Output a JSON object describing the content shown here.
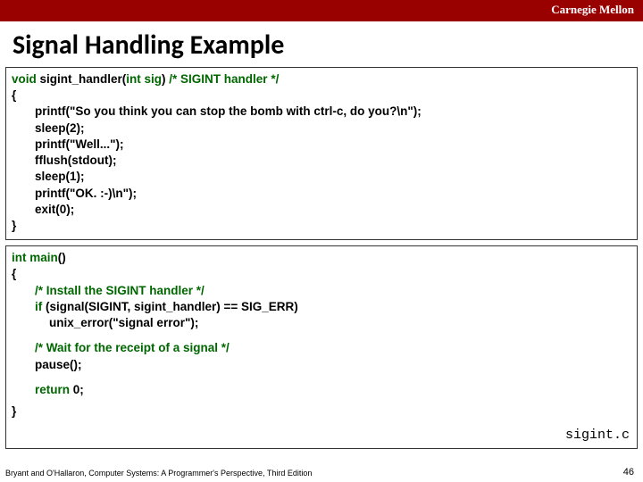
{
  "header": {
    "cmu": "Carnegie Mellon"
  },
  "title": "Signal Handling Example",
  "code1": {
    "sig_void": "void",
    "sig_name": " sigint_handler(",
    "sig_int": "int",
    "sig_param": " sig",
    "sig_close": ") ",
    "sig_comment": "/* SIGINT handler */",
    "open": "{",
    "l1": "printf(\"So you think you can stop the bomb with ctrl-c, do you?\\n\");",
    "l2": "sleep(2);",
    "l3": "printf(\"Well...\");",
    "l4": "fflush(stdout);",
    "l5": "sleep(1);",
    "l6": "printf(\"OK. :-)\\n\");",
    "l7": "exit(0);",
    "close": "}"
  },
  "code2": {
    "main_int": "int",
    "main_name": " main",
    "main_paren": "()",
    "open": "{",
    "c1": "/* Install the SIGINT handler */",
    "if_kw": "if",
    "if_rest": " (signal(SIGINT, sigint_handler) == SIG_ERR)",
    "err": "unix_error(\"signal error\");",
    "c2": "/* Wait for the receipt of a signal */",
    "pause": "pause();",
    "ret_kw": "return",
    "ret_rest": " 0;",
    "close": "}",
    "filename": "sigint.c"
  },
  "footer": {
    "left": "Bryant and O'Hallaron, Computer Systems: A Programmer's Perspective, Third Edition",
    "page": "46"
  }
}
